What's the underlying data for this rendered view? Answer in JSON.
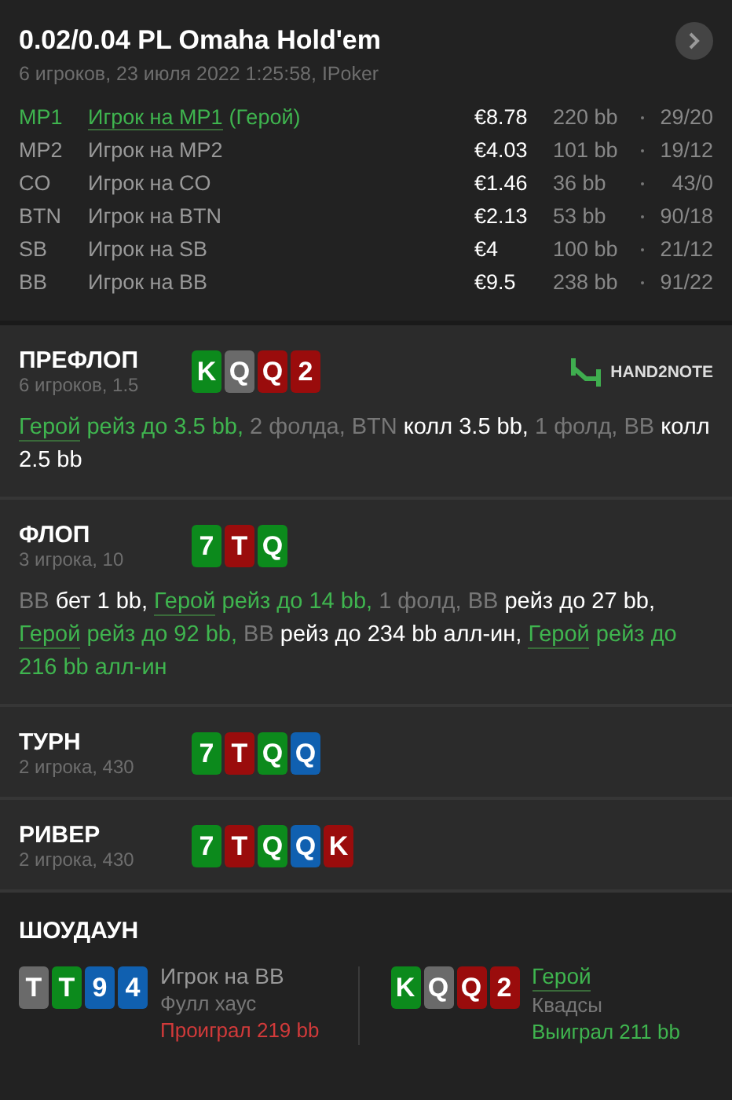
{
  "header": {
    "title": "0.02/0.04 PL Omaha Hold'em",
    "subtitle": "6 игроков, 23 июля 2022 1:25:58, IPoker"
  },
  "players": [
    {
      "position": "MP1",
      "name": "Игрок на MP1",
      "hero": true,
      "hero_tag": "(Герой)",
      "stack": "€8.78",
      "bb": "220 bb",
      "stats": "29/20"
    },
    {
      "position": "MP2",
      "name": "Игрок на MP2",
      "hero": false,
      "stack": "€4.03",
      "bb": "101 bb",
      "stats": "19/12"
    },
    {
      "position": "CO",
      "name": "Игрок на CO",
      "hero": false,
      "stack": "€1.46",
      "bb": "36 bb",
      "stats": "43/0"
    },
    {
      "position": "BTN",
      "name": "Игрок на BTN",
      "hero": false,
      "stack": "€2.13",
      "bb": "53 bb",
      "stats": "90/18"
    },
    {
      "position": "SB",
      "name": "Игрок на SB",
      "hero": false,
      "stack": "€4",
      "bb": "100 bb",
      "stats": "21/12"
    },
    {
      "position": "BB",
      "name": "Игрок на BB",
      "hero": false,
      "stack": "€9.5",
      "bb": "238 bb",
      "stats": "91/22"
    }
  ],
  "streets": [
    {
      "name": "ПРЕФЛОП",
      "info": "6 игроков, 1.5",
      "logo": "HAND2NOTE",
      "cards": [
        {
          "rank": "K",
          "color": "#0c8a1c"
        },
        {
          "rank": "Q",
          "color": "#6a6a6a"
        },
        {
          "rank": "Q",
          "color": "#9a0c0c"
        },
        {
          "rank": "2",
          "color": "#9a0c0c"
        }
      ],
      "actions": [
        {
          "text": "Герой",
          "kind": "hero"
        },
        {
          "text": " рейз до 3.5 bb,",
          "kind": "hero_action"
        },
        {
          "text": " 2 фолда, BTN",
          "kind": "muted"
        },
        {
          "text": " колл 3.5 bb,",
          "kind": "action"
        },
        {
          "text": " 1 фолд, BB",
          "kind": "muted"
        },
        {
          "text": " колл 2.5 bb",
          "kind": "action"
        }
      ]
    },
    {
      "name": "ФЛОП",
      "info": "3 игрока, 10",
      "cards": [
        {
          "rank": "7",
          "color": "#0c8a1c"
        },
        {
          "rank": "T",
          "color": "#9a0c0c"
        },
        {
          "rank": "Q",
          "color": "#0c8a1c"
        }
      ],
      "actions": [
        {
          "text": "BB",
          "kind": "muted"
        },
        {
          "text": " бет 1 bb, ",
          "kind": "action"
        },
        {
          "text": "Герой",
          "kind": "hero"
        },
        {
          "text": " рейз до 14 bb,",
          "kind": "hero_action"
        },
        {
          "text": " 1 фолд, BB",
          "kind": "muted"
        },
        {
          "text": " рейз до 27 bb, ",
          "kind": "action"
        },
        {
          "text": "Герой",
          "kind": "hero"
        },
        {
          "text": " рейз до 92 bb,",
          "kind": "hero_action"
        },
        {
          "text": " BB",
          "kind": "muted"
        },
        {
          "text": " рейз до 234 bb алл-ин, ",
          "kind": "action"
        },
        {
          "text": "Герой",
          "kind": "hero"
        },
        {
          "text": " рейз до 216 bb алл-ин",
          "kind": "hero_action"
        }
      ]
    },
    {
      "name": "ТУРН",
      "info": "2 игрока, 430",
      "cards": [
        {
          "rank": "7",
          "color": "#0c8a1c"
        },
        {
          "rank": "T",
          "color": "#9a0c0c"
        },
        {
          "rank": "Q",
          "color": "#0c8a1c"
        },
        {
          "rank": "Q",
          "color": "#1060b0"
        }
      ]
    },
    {
      "name": "РИВЕР",
      "info": "2 игрока, 430",
      "cards": [
        {
          "rank": "7",
          "color": "#0c8a1c"
        },
        {
          "rank": "T",
          "color": "#9a0c0c"
        },
        {
          "rank": "Q",
          "color": "#0c8a1c"
        },
        {
          "rank": "Q",
          "color": "#1060b0"
        },
        {
          "rank": "K",
          "color": "#9a0c0c"
        }
      ]
    }
  ],
  "showdown": {
    "title": "ШОУДАУН",
    "hands": [
      {
        "cards": [
          {
            "rank": "T",
            "color": "#6a6a6a"
          },
          {
            "rank": "T",
            "color": "#0c8a1c"
          },
          {
            "rank": "9",
            "color": "#1060b0"
          },
          {
            "rank": "4",
            "color": "#1060b0"
          }
        ],
        "player": "Игрок на BB",
        "hero": false,
        "hand": "Фулл хаус",
        "result": "Проиграл 219 bb",
        "won": false
      },
      {
        "cards": [
          {
            "rank": "K",
            "color": "#0c8a1c"
          },
          {
            "rank": "Q",
            "color": "#6a6a6a"
          },
          {
            "rank": "Q",
            "color": "#9a0c0c"
          },
          {
            "rank": "2",
            "color": "#9a0c0c"
          }
        ],
        "player": "Герой",
        "hero": true,
        "hand": "Квадсы",
        "result": "Выиграл 211 bb",
        "won": true
      }
    ]
  }
}
